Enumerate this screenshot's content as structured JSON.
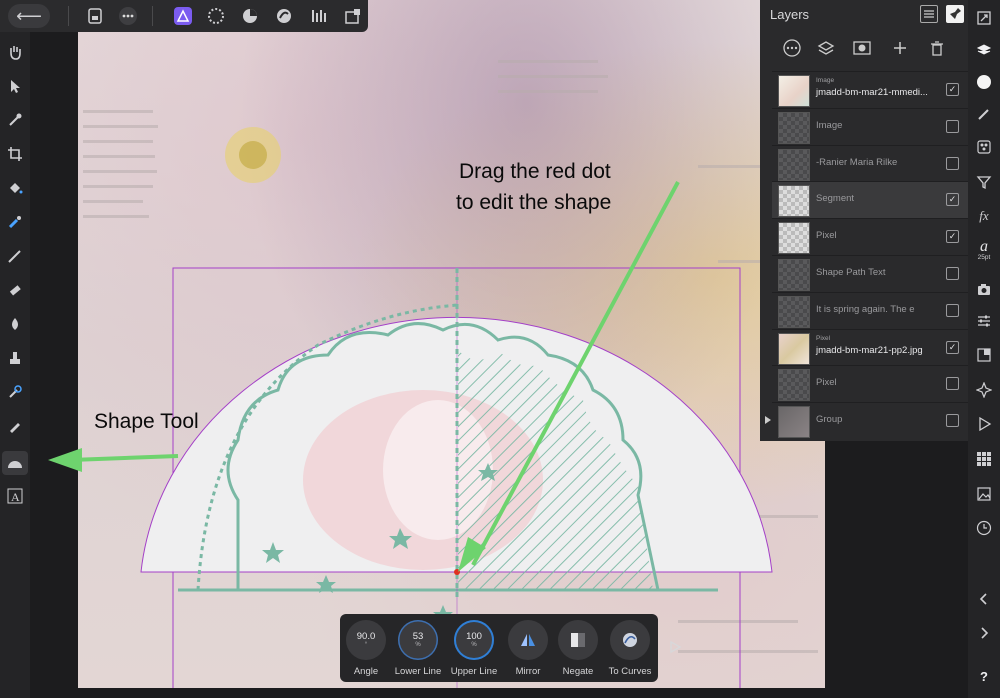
{
  "topbar": {
    "back_glyph": "⟵",
    "buttons": [
      "document-icon",
      "more-icon",
      "designer-persona-icon",
      "pixel-persona-icon",
      "export-persona-icon",
      "affinity-photo-icon",
      "tone-map-icon",
      "liquify-icon"
    ]
  },
  "annotations": {
    "drag_line1": "Drag the red dot",
    "drag_line2": "to edit the shape",
    "shape_tool": "Shape Tool"
  },
  "layers_panel": {
    "title": "Layers",
    "layers": [
      {
        "sub": "Image",
        "name": "jmadd-bm-mar21-mmedi...",
        "visible": true,
        "selected": false
      },
      {
        "sub": "",
        "name": "Image",
        "visible": false,
        "selected": false
      },
      {
        "sub": "",
        "name": "-Ranier Maria Rilke",
        "visible": false,
        "selected": false
      },
      {
        "sub": "",
        "name": "Segment",
        "visible": true,
        "selected": true
      },
      {
        "sub": "",
        "name": "Pixel",
        "visible": true,
        "selected": false
      },
      {
        "sub": "",
        "name": "Shape Path Text",
        "visible": false,
        "selected": false
      },
      {
        "sub": "",
        "name": "It is spring again. The e",
        "visible": false,
        "selected": false
      },
      {
        "sub": "Pixel",
        "name": "jmadd-bm-mar21-pp2.jpg",
        "visible": true,
        "selected": false
      },
      {
        "sub": "",
        "name": "Pixel",
        "visible": false,
        "selected": false
      },
      {
        "sub": "",
        "name": "Group",
        "visible": false,
        "selected": false
      }
    ]
  },
  "context_toolbar": {
    "angle": {
      "value": "90.0",
      "unit": "°",
      "label": "Angle"
    },
    "lower_line": {
      "value": "53",
      "unit": "%",
      "label": "Lower Line"
    },
    "upper_line": {
      "value": "100",
      "unit": "%",
      "label": "Upper Line"
    },
    "mirror": {
      "label": "Mirror"
    },
    "negate": {
      "label": "Negate"
    },
    "to_curves": {
      "label": "To Curves"
    }
  },
  "right_studio": {
    "font_size_label": "25pt",
    "help_label": "?"
  },
  "colors": {
    "accent": "#7b5cf0",
    "arrow_green": "#6ed36e",
    "shape_fill": "#efeff0",
    "selection": "#a440c8",
    "node_red": "#e03020"
  }
}
